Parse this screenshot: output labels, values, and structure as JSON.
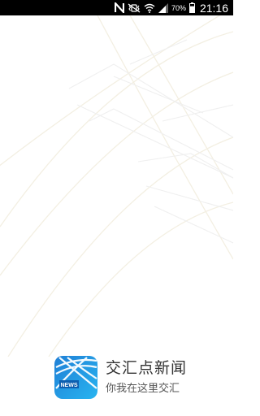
{
  "status_bar": {
    "nfc_icon": "nfc-icon",
    "mute_icon": "vibrate-off-icon",
    "wifi_icon": "wifi-icon",
    "signal_icon": "cell-signal-icon",
    "battery_percent": "70%",
    "battery_level": 0.7,
    "time": "21:16"
  },
  "splash": {
    "app_name": "交汇点新闻",
    "slogan": "你我在这里交汇",
    "logo_text": "NEWS",
    "logo_colors": [
      "#1f7fd6",
      "#28b4f0"
    ]
  }
}
